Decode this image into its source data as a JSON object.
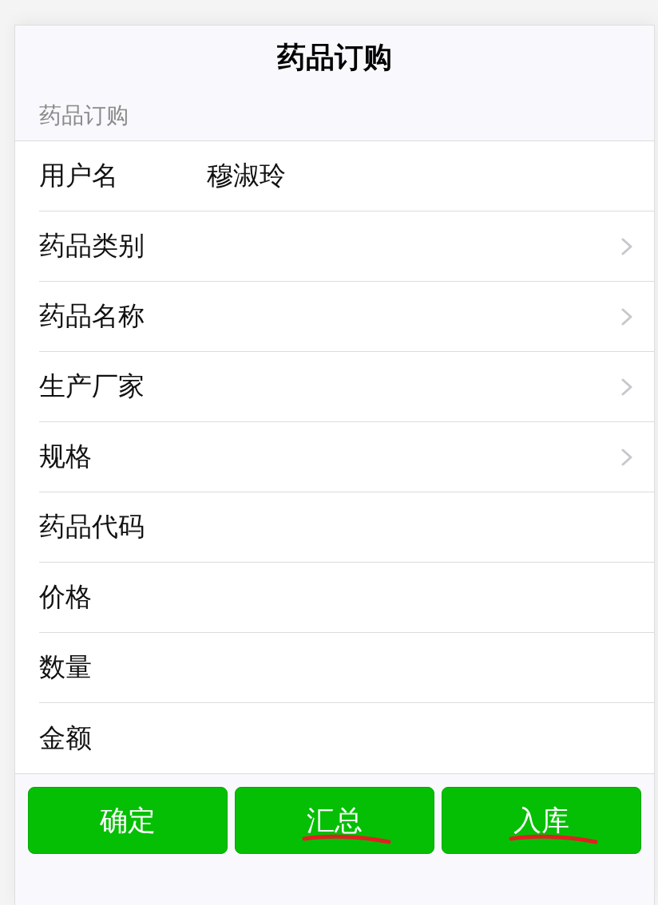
{
  "header": {
    "title": "药品订购"
  },
  "section": {
    "title": "药品订购"
  },
  "fields": [
    {
      "kind": "text",
      "label": "用户名",
      "value": "穆淑玲"
    },
    {
      "kind": "picker",
      "label": "药品类别"
    },
    {
      "kind": "picker",
      "label": "药品名称"
    },
    {
      "kind": "picker",
      "label": "生产厂家"
    },
    {
      "kind": "picker",
      "label": "规格"
    },
    {
      "kind": "input",
      "label": "药品代码"
    },
    {
      "kind": "input",
      "label": "价格"
    },
    {
      "kind": "input",
      "label": "数量"
    },
    {
      "kind": "input",
      "label": "金额"
    }
  ],
  "buttons": [
    {
      "label": "确定",
      "marked": false
    },
    {
      "label": "汇总",
      "marked": true
    },
    {
      "label": "入库",
      "marked": true
    }
  ]
}
